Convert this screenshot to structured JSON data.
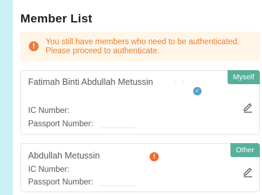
{
  "page": {
    "title": "Member List"
  },
  "alert": {
    "icon": "exclamation-circle-icon",
    "message": "You still have members who need to be authenticated. Please proceed to authenticate."
  },
  "colors": {
    "background": "#c9f0f5",
    "accent_tag": "#59b09a",
    "warning_text": "#e87f35",
    "verified_icon": "#5ba2c5",
    "unverified_icon": "#f06b2e"
  },
  "members": [
    {
      "name": "Fatimah Binti Abdullah Metussin",
      "tag": "Myself",
      "status": "verified",
      "status_icon": "check-circle-icon",
      "ic_label": "IC Number:",
      "passport_label": "Passport Number:",
      "edit_icon": "edit-pencil-icon"
    },
    {
      "name": "Abdullah Metussin",
      "tag": "Other",
      "status": "unverified",
      "status_icon": "exclamation-circle-icon",
      "ic_label": "IC Number:",
      "passport_label": "Passport Number:",
      "edit_icon": "edit-pencil-icon"
    }
  ]
}
